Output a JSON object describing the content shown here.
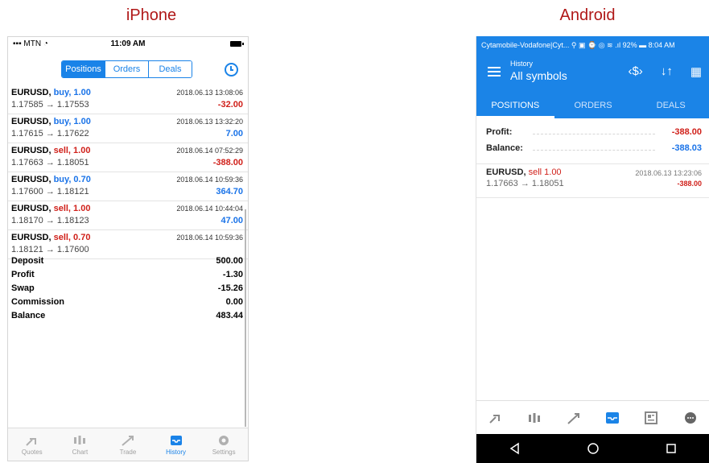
{
  "captions": {
    "iphone": "iPhone",
    "android": "Android"
  },
  "iphone": {
    "status": {
      "carrier": "MTN",
      "time": "11:09 AM"
    },
    "segments": [
      "Positions",
      "Orders",
      "Deals"
    ],
    "deals": [
      {
        "symbol": "EURUSD,",
        "side": "buy, 1.00",
        "side_type": "buy",
        "time": "2018.06.13 13:08:06",
        "prices": "1.17585 → 1.17553",
        "profit": "-32.00"
      },
      {
        "symbol": "EURUSD,",
        "side": "buy, 1.00",
        "side_type": "buy",
        "time": "2018.06.13 13:32:20",
        "prices": "1.17615 → 1.17622",
        "profit": "7.00"
      },
      {
        "symbol": "EURUSD,",
        "side": "sell, 1.00",
        "side_type": "sell",
        "time": "2018.06.14 07:52:29",
        "prices": "1.17663 → 1.18051",
        "profit": "-388.00"
      },
      {
        "symbol": "EURUSD,",
        "side": "buy, 0.70",
        "side_type": "buy",
        "time": "2018.06.14 10:59:36",
        "prices": "1.17600 → 1.18121",
        "profit": "364.70"
      },
      {
        "symbol": "EURUSD,",
        "side": "sell, 1.00",
        "side_type": "sell",
        "time": "2018.06.14 10:44:04",
        "prices": "1.18170 → 1.18123",
        "profit": "47.00"
      },
      {
        "symbol": "EURUSD,",
        "side": "sell, 0.70",
        "side_type": "sell",
        "time": "2018.06.14 10:59:36",
        "prices": "1.18121 → 1.17600",
        "profit": ""
      }
    ],
    "summary": [
      {
        "label": "Deposit",
        "value": "500.00"
      },
      {
        "label": "Profit",
        "value": "-1.30"
      },
      {
        "label": "Swap",
        "value": "-15.26"
      },
      {
        "label": "Commission",
        "value": "0.00"
      },
      {
        "label": "Balance",
        "value": "483.44"
      }
    ],
    "tabs": [
      {
        "label": "Quotes",
        "icon": "quotes-icon"
      },
      {
        "label": "Chart",
        "icon": "chart-icon"
      },
      {
        "label": "Trade",
        "icon": "trade-icon"
      },
      {
        "label": "History",
        "icon": "history-icon"
      },
      {
        "label": "Settings",
        "icon": "settings-icon"
      }
    ]
  },
  "android": {
    "status_bar": "Cytamobile-Vodafone|Cyt... ⚲ ▣ ⌚ ◎ ≋ .ıl 92% ▬ 8:04 AM",
    "title_small": "History",
    "title": "All symbols",
    "tabs": [
      "POSITIONS",
      "ORDERS",
      "DEALS"
    ],
    "profit_label": "Profit:",
    "profit_value": "-388.00",
    "balance_label": "Balance:",
    "balance_value": "-388.03",
    "deal": {
      "symbol": "EURUSD,",
      "side": "sell 1.00",
      "time": "2018.06.13 13:23:06",
      "prices": "1.17663 → 1.18051",
      "profit": "-388.00"
    },
    "colors": {
      "accent": "#1b84e7",
      "loss": "#d0201a",
      "gain": "#1a73e8"
    }
  }
}
